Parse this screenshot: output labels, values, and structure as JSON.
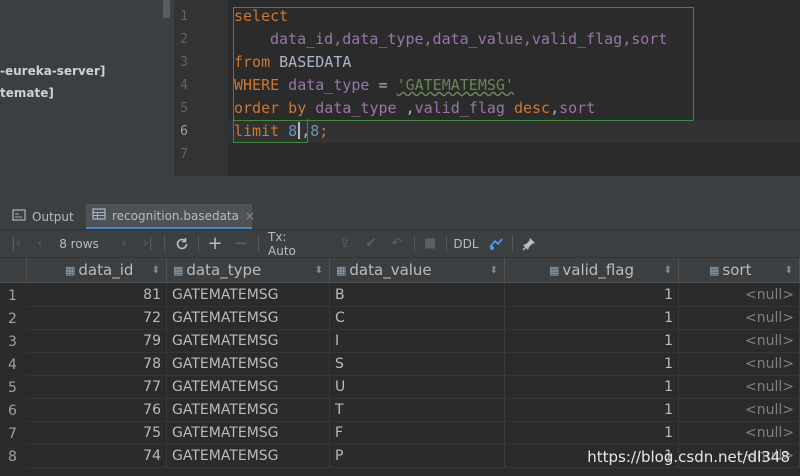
{
  "project": {
    "items": [
      "-eureka-server]",
      "temate]"
    ]
  },
  "editor": {
    "line_numbers": [
      "1",
      "2",
      "3",
      "4",
      "5",
      "6",
      "7"
    ],
    "lines": [
      {
        "k1": "select"
      },
      {
        "cols": "data_id,data_type,data_value,valid_flag,sort"
      },
      {
        "k1": "from",
        "t": " BASEDATA"
      },
      {
        "k1": "WHERE",
        "c1": " data_type",
        "t": " = ",
        "s": "'GATEMATEMSG'"
      },
      {
        "k1": "order by",
        "c1": " data_type",
        "t1": " ,",
        "c2": "valid_flag",
        "k2": " desc",
        "t2": ",",
        "c3": "sort"
      },
      {
        "k1": "limit",
        "n1": " 8",
        "t": ",",
        "n2": "8",
        "t2": ";"
      }
    ]
  },
  "tabs": {
    "output": "Output",
    "table": "recognition.basedata",
    "close": "×"
  },
  "toolbar": {
    "rows": "8 rows",
    "tx": "Tx: Auto",
    "ddl": "DDL"
  },
  "table": {
    "columns": [
      "data_id",
      "data_type",
      "data_value",
      "valid_flag",
      "sort"
    ],
    "rows": [
      {
        "n": "1",
        "data_id": "81",
        "data_type": "GATEMATEMSG",
        "data_value": "B",
        "valid_flag": "1",
        "sort": "<null>"
      },
      {
        "n": "2",
        "data_id": "72",
        "data_type": "GATEMATEMSG",
        "data_value": "C",
        "valid_flag": "1",
        "sort": "<null>"
      },
      {
        "n": "3",
        "data_id": "79",
        "data_type": "GATEMATEMSG",
        "data_value": "I",
        "valid_flag": "1",
        "sort": "<null>"
      },
      {
        "n": "4",
        "data_id": "78",
        "data_type": "GATEMATEMSG",
        "data_value": "S",
        "valid_flag": "1",
        "sort": "<null>"
      },
      {
        "n": "5",
        "data_id": "77",
        "data_type": "GATEMATEMSG",
        "data_value": "U",
        "valid_flag": "1",
        "sort": "<null>"
      },
      {
        "n": "6",
        "data_id": "76",
        "data_type": "GATEMATEMSG",
        "data_value": "T",
        "valid_flag": "1",
        "sort": "<null>"
      },
      {
        "n": "7",
        "data_id": "75",
        "data_type": "GATEMATEMSG",
        "data_value": "F",
        "valid_flag": "1",
        "sort": "<null>"
      },
      {
        "n": "8",
        "data_id": "74",
        "data_type": "GATEMATEMSG",
        "data_value": "P",
        "valid_flag": "1",
        "sort": "<null>"
      }
    ]
  },
  "watermark": "https://blog.csdn.net/dl348"
}
